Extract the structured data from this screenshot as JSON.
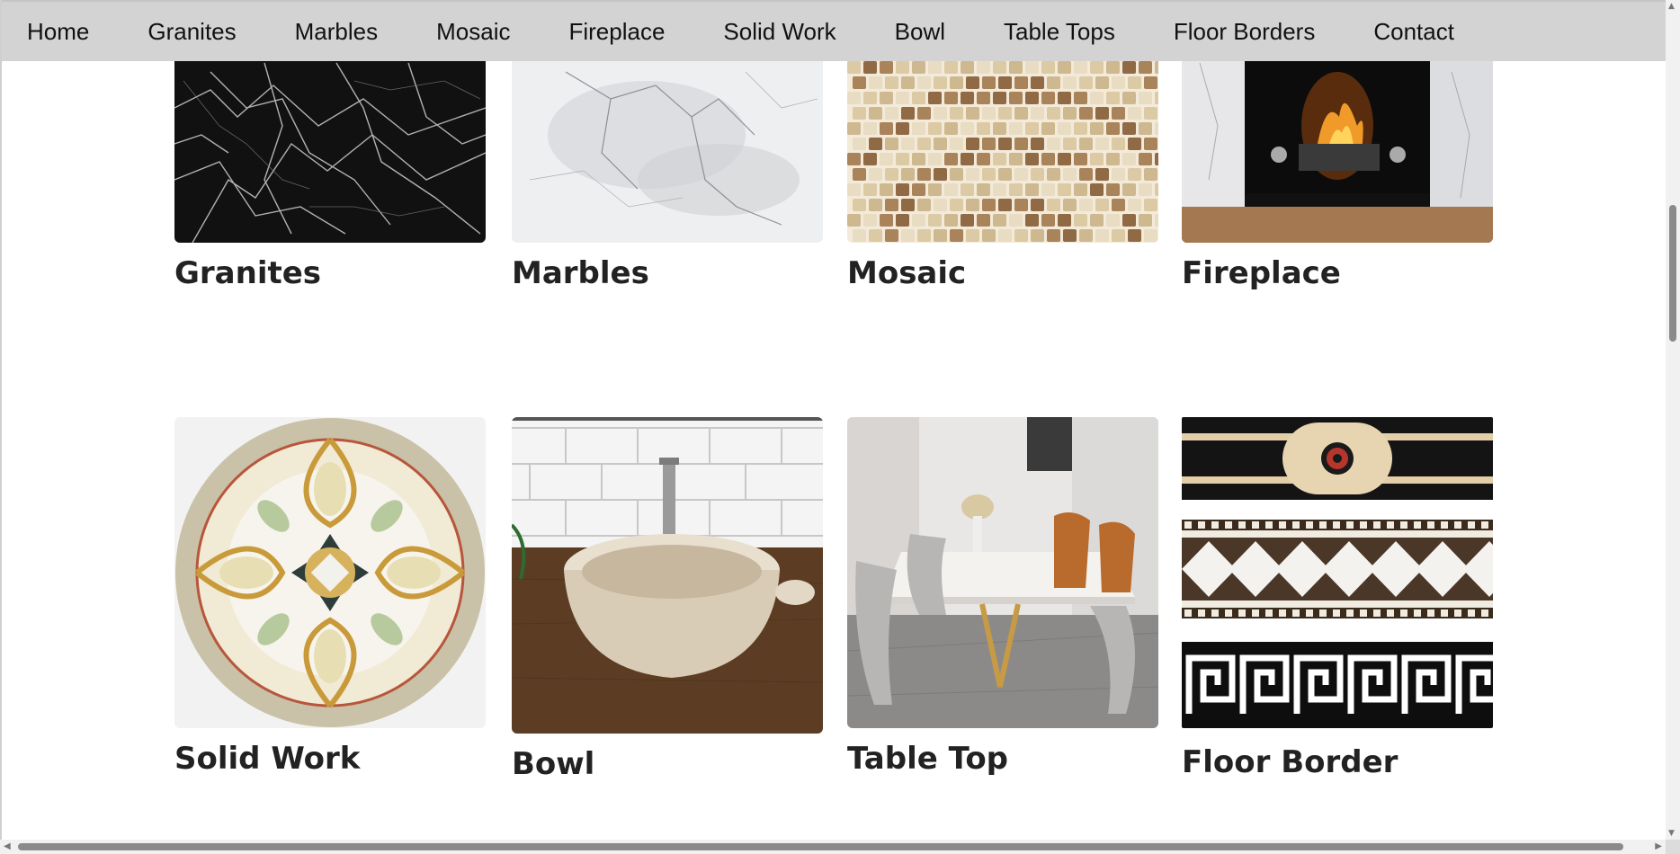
{
  "nav": {
    "items": [
      {
        "label": "Home"
      },
      {
        "label": "Granites"
      },
      {
        "label": "Marbles"
      },
      {
        "label": "Mosaic"
      },
      {
        "label": "Fireplace"
      },
      {
        "label": "Solid Work"
      },
      {
        "label": "Bowl"
      },
      {
        "label": "Table Tops"
      },
      {
        "label": "Floor Borders"
      },
      {
        "label": "Contact"
      }
    ]
  },
  "gallery": {
    "cards": [
      {
        "caption": "Granites",
        "icon": "black-granite-texture"
      },
      {
        "caption": "Marbles",
        "icon": "white-marble-texture"
      },
      {
        "caption": "Mosaic",
        "icon": "mosaic-tiles"
      },
      {
        "caption": "Fireplace",
        "icon": "fireplace"
      },
      {
        "caption": "Solid Work",
        "icon": "medallion-inlay"
      },
      {
        "caption": "Bowl",
        "icon": "stone-bowl-sink"
      },
      {
        "caption": "Table Top",
        "icon": "marble-dining-table"
      },
      {
        "caption": "Floor Border",
        "icon": "floor-border-patterns"
      }
    ]
  },
  "colors": {
    "nav_bg": "#d3d3d3",
    "caption": "#222222",
    "scroll_thumb": "#8a8a8a"
  }
}
